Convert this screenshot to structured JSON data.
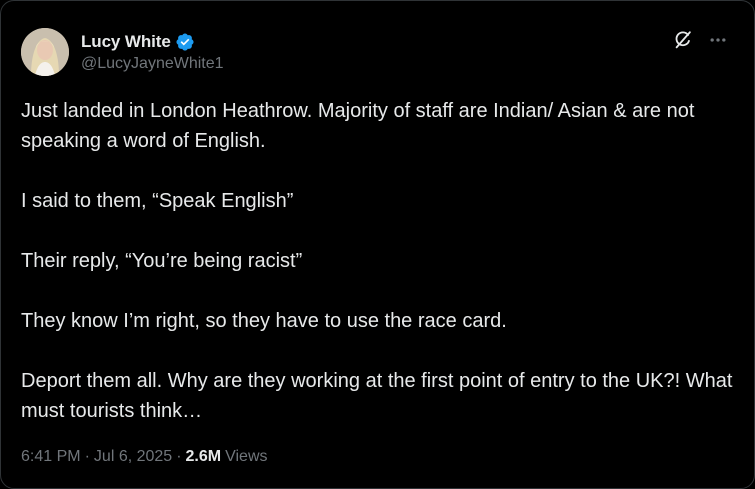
{
  "author": {
    "display_name": "Lucy White",
    "handle": "@LucyJayneWhite1",
    "verified": true
  },
  "icons": {
    "verified": "verified-badge-icon",
    "grok": "grok-icon",
    "more": "more-icon"
  },
  "colors": {
    "background": "#000000",
    "text_primary": "#e7e9ea",
    "text_secondary": "#71767b",
    "verified_blue": "#1d9bf0",
    "border": "#2f3336"
  },
  "tweet": {
    "paragraphs": [
      "Just landed in London Heathrow. Majority of staff are Indian/ Asian & are not speaking a word of English.",
      "I said to them, “Speak English”",
      "Their reply, “You’re being racist”",
      "They know I’m right, so they have to use the race card.",
      "Deport them all. Why are they working at the first point of entry to the UK?! What must tourists think…"
    ],
    "time": "6:41 PM",
    "separator": "·",
    "date": "Jul 6, 2025",
    "views_count": "2.6M",
    "views_label": "Views"
  }
}
